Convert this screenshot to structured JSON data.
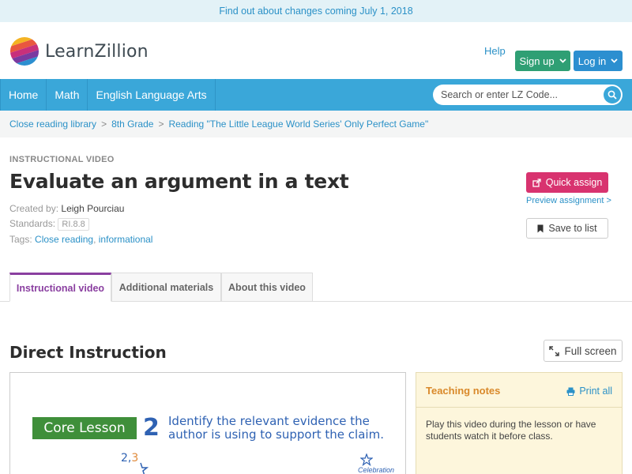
{
  "announcement": "Find out about changes coming July 1, 2018",
  "header": {
    "logo_text": "LearnZillion",
    "help": "Help",
    "signup": "Sign up",
    "login": "Log in"
  },
  "nav": {
    "items": [
      "Home",
      "Math",
      "English Language Arts"
    ],
    "search_placeholder": "Search or enter LZ Code..."
  },
  "breadcrumb": [
    "Close reading library",
    "8th Grade",
    "Reading \"The Little League World Series' Only Perfect Game\""
  ],
  "lesson": {
    "eyebrow": "INSTRUCTIONAL VIDEO",
    "title": "Evaluate an argument in a text",
    "created_by_label": "Created by:",
    "created_by": "Leigh Pourciau",
    "standards_label": "Standards:",
    "standard": "RI.8.8",
    "tags_label": "Tags:",
    "tags": [
      "Close reading",
      "informational"
    ]
  },
  "actions": {
    "quick_assign": "Quick assign",
    "preview": "Preview assignment >",
    "save": "Save to list"
  },
  "tabs": [
    "Instructional video",
    "Additional materials",
    "About this video"
  ],
  "section_title": "Direct Instruction",
  "fullscreen": "Full screen",
  "video": {
    "core_label": "Core Lesson",
    "number": "2",
    "text": "Identify the relevant evidence the author is using to support the claim.",
    "scrawl_a": "2",
    "scrawl_b": "3",
    "celebration": "Celebration"
  },
  "notes": {
    "title": "Teaching notes",
    "print": "Print all",
    "body": "Play this video during the lesson or have students watch it before class."
  },
  "colors": {
    "nav": "#3aa7d9",
    "signup": "#2f9f74",
    "login": "#2c8fd0",
    "quick_assign": "#d8336f",
    "tab_active": "#8a3fa0",
    "notes_bg": "#fdf6dc"
  }
}
